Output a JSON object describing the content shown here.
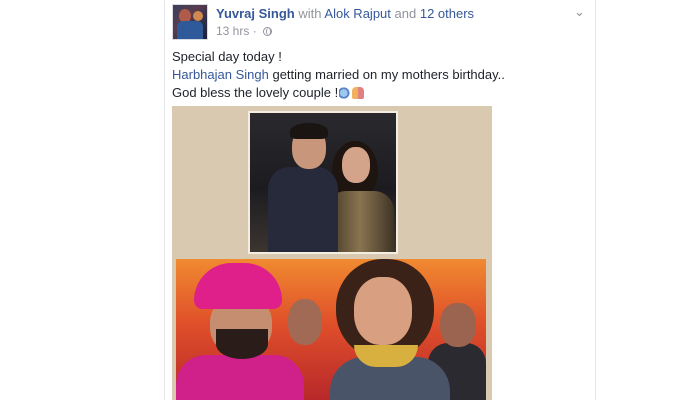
{
  "post": {
    "author": "Yuvraj Singh",
    "with_text": "with",
    "tagged": "Alok Rajput",
    "and_text": "and",
    "others": "12 others",
    "time": "13 hrs",
    "dot": "·",
    "privacy_icon": "globe-icon",
    "menu_icon": "chevron-down-icon",
    "message_line1": "Special day today !",
    "mention": "Harbhajan Singh",
    "message_line2_rest": " getting married on my mothers birthday..",
    "message_line3": "God bless the lovely couple !"
  },
  "emojis": [
    "praying-hands-emoji",
    "couple-emoji"
  ],
  "colors": {
    "link": "#365899",
    "muted": "#90949c",
    "text": "#1d2129"
  }
}
